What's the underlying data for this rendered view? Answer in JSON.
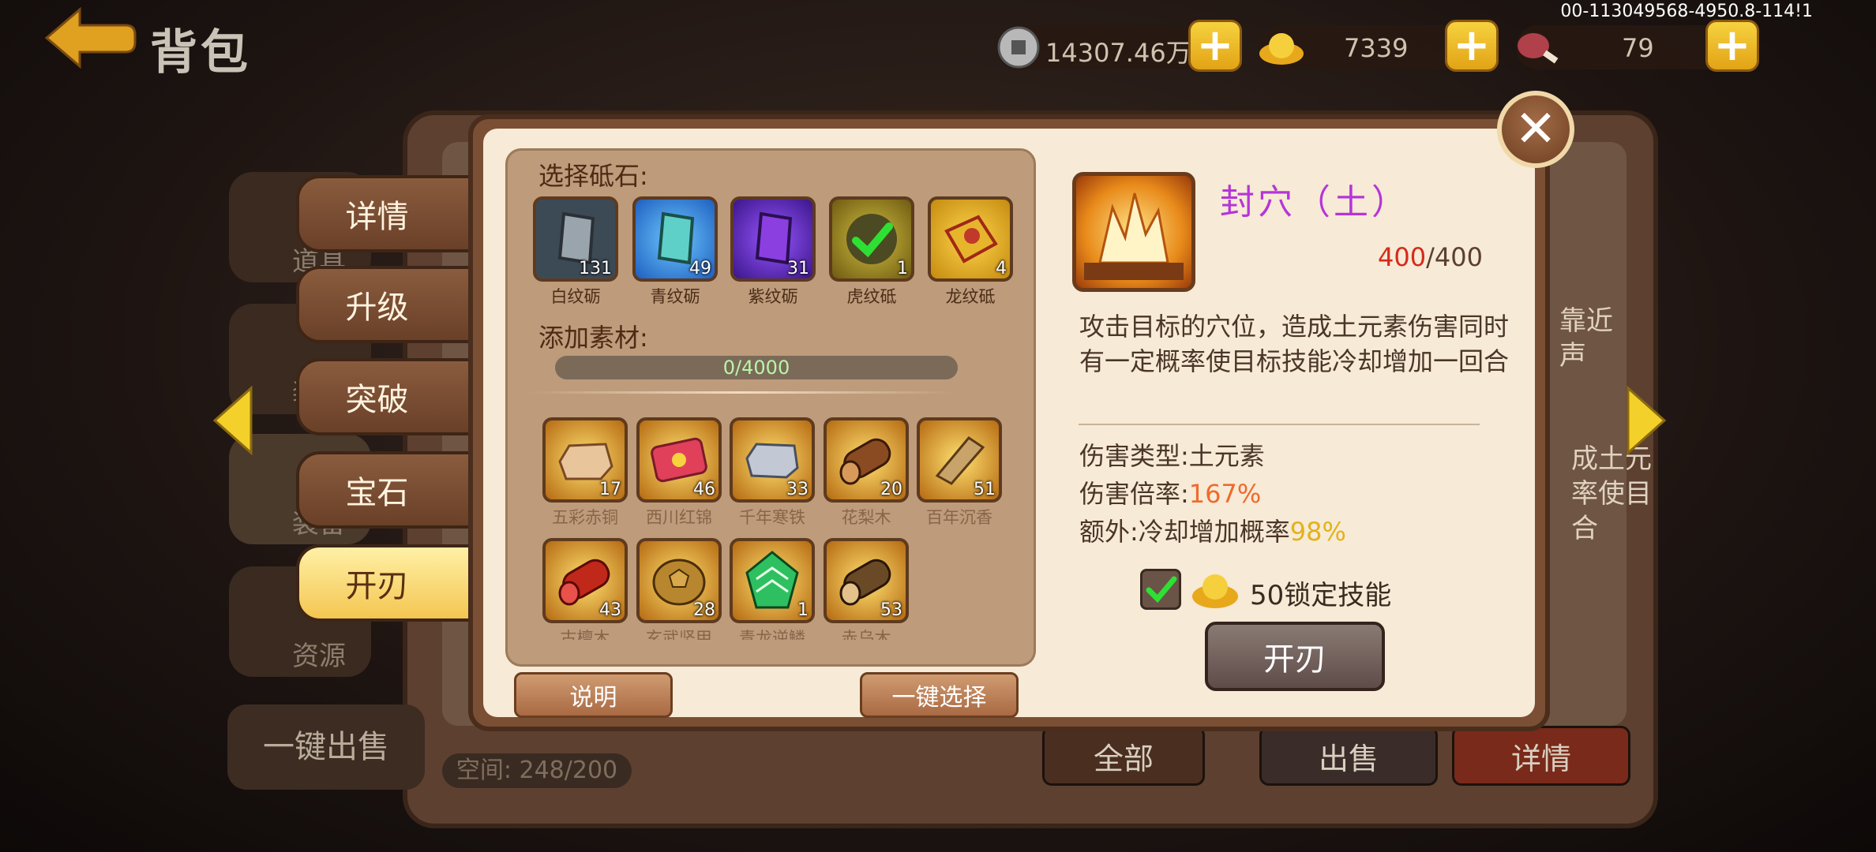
{
  "header": {
    "title": "背包",
    "debug_id": "00-113049568-4950.8-114!1",
    "coins": "14307.46万",
    "ingots": "7339",
    "meat": "79"
  },
  "background": {
    "categories": [
      "道具",
      "装",
      "装备",
      "资源"
    ],
    "one_click_sell": "一键出售",
    "space": "空间: 248/200",
    "btn_all": "全部",
    "btn_sell": "出售",
    "btn_detail": "详情",
    "partial_text": [
      "靠近",
      "声",
      "成土元",
      "率使目",
      "合"
    ]
  },
  "tabs": [
    {
      "label": "详情",
      "active": false
    },
    {
      "label": "升级",
      "active": false
    },
    {
      "label": "突破",
      "active": false
    },
    {
      "label": "宝石",
      "active": false
    },
    {
      "label": "开刃",
      "active": true
    }
  ],
  "popup": {
    "select_whetstone_label": "选择砥石:",
    "whetstones": [
      {
        "name": "白纹砺",
        "count": "131",
        "icon": "white-stone-icon",
        "color": "#9aa4ac"
      },
      {
        "name": "青纹砺",
        "count": "49",
        "icon": "cyan-stone-icon",
        "color": "#5fd0c7"
      },
      {
        "name": "紫纹砺",
        "count": "31",
        "icon": "purple-stone-icon",
        "color": "#8c3fe0"
      },
      {
        "name": "虎纹砥",
        "count": "1",
        "icon": "tiger-stone-icon",
        "color": "#6e6a1e",
        "selected": true
      },
      {
        "name": "龙纹砥",
        "count": "4",
        "icon": "dragon-stone-icon",
        "color": "#e6b52c"
      }
    ],
    "add_material_label": "添加素材:",
    "progress": "0/4000",
    "materials": [
      {
        "name": "五彩赤铜",
        "count": "17",
        "icon": "copper-ingot-icon"
      },
      {
        "name": "西川红锦",
        "count": "46",
        "icon": "red-brocade-icon"
      },
      {
        "name": "千年寒铁",
        "count": "33",
        "icon": "cold-iron-icon"
      },
      {
        "name": "花梨木",
        "count": "20",
        "icon": "rosewood-log-icon"
      },
      {
        "name": "百年沉香",
        "count": "51",
        "icon": "agarwood-icon"
      },
      {
        "name": "古檀木",
        "count": "43",
        "icon": "sandalwood-log-icon"
      },
      {
        "name": "玄武坚甲",
        "count": "28",
        "icon": "turtle-shell-icon"
      },
      {
        "name": "青龙逆鳞",
        "count": "1",
        "icon": "dragon-scale-icon"
      },
      {
        "name": "赤乌木",
        "count": "53",
        "icon": "ebony-log-icon"
      }
    ],
    "btn_explain": "说明",
    "btn_one_select": "一键选择",
    "skill": {
      "name": "封穴（土）",
      "level_current": "400",
      "level_max": "/400",
      "description": "攻击目标的穴位，造成土元素伤害同时有一定概率使目标技能冷却增加一回合",
      "damage_type_label": "伤害类型:",
      "damage_type": "土元素",
      "damage_rate_label": "伤害倍率:",
      "damage_rate": "167%",
      "extra_label": "额外:冷却增加概率",
      "extra_value": "98%"
    },
    "lock_text": "50锁定技能",
    "btn_open": "开刃"
  }
}
